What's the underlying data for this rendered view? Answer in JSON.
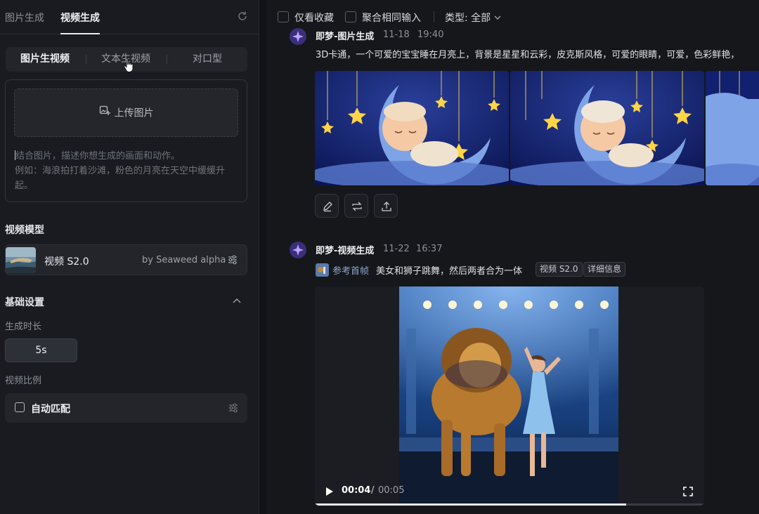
{
  "left": {
    "top_tabs": [
      "图片生成",
      "视频生成"
    ],
    "mode_tabs": [
      "图片生视频",
      "文本生视频",
      "对口型"
    ],
    "upload_label": "上传图片",
    "prompt_placeholder_line1": "结合图片，描述你想生成的画面和动作。",
    "prompt_placeholder_line2": "例如：海浪拍打着沙滩，粉色的月亮在天空中缓缓升起。",
    "model_section": "视频模型",
    "model_name": "视频 S2.0",
    "model_by": "by Seaweed alpha",
    "basic_settings": "基础设置",
    "duration_label": "生成时长",
    "duration_value": "5s",
    "ratio_label": "视频比例",
    "ratio_value": "自动匹配"
  },
  "right": {
    "filters": {
      "favorites_only": "仅看收藏",
      "merge_inputs": "聚合相同输入",
      "type": "类型: 全部"
    },
    "item1": {
      "source": "即梦-图片生成",
      "date": "11-18",
      "time": "19:40",
      "prompt": "3D卡通，一个可爱的宝宝睡在月亮上，背景是星星和云彩，皮克斯风格，可爱的眼睛，可爱，色彩鲜艳，"
    },
    "item2": {
      "source": "即梦-视频生成",
      "date": "11-22",
      "time": "16:37",
      "ref_label": "参考首帧",
      "prompt": "美女和狮子跳舞，然后两者合为一体",
      "model_tag": "视频 S2.0",
      "detail_tag": "详细信息",
      "current_time": "00:04",
      "separator": "/",
      "total_time": "00:05",
      "progress_fraction": 0.8
    }
  }
}
